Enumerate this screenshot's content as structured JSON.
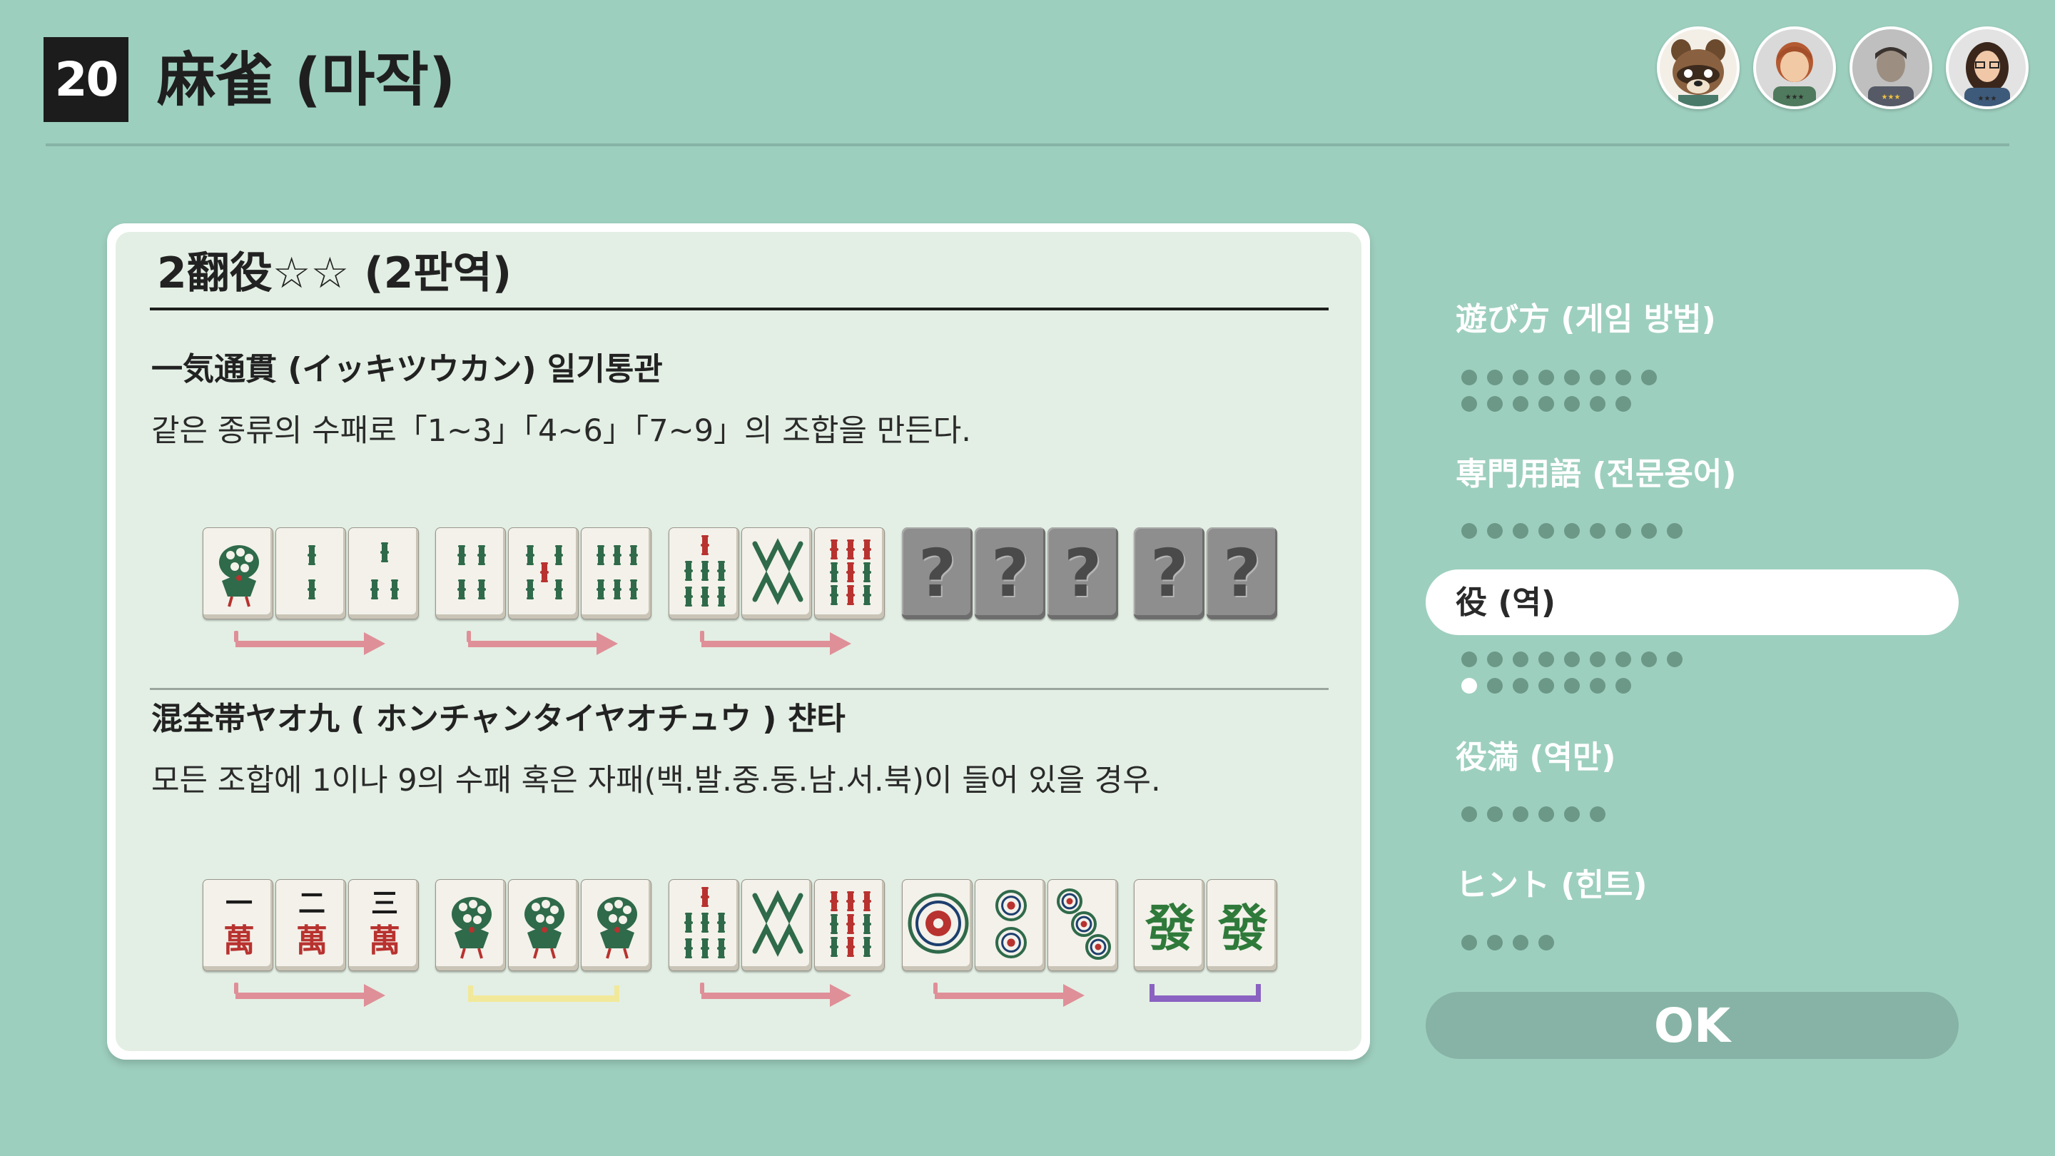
{
  "header": {
    "lesson_number": "20",
    "title": "麻雀 (마작)"
  },
  "players": [
    {
      "name": "tom-nook-avatar"
    },
    {
      "name": "player-avatar-2",
      "stars": "★★★"
    },
    {
      "name": "player-avatar-3",
      "stars": "★★★"
    },
    {
      "name": "player-avatar-4",
      "stars": "★★★"
    }
  ],
  "card": {
    "title": "2翻役☆☆ (2판역)",
    "yaku": [
      {
        "title": "一気通貫 (イッキツウカン) 일기통관",
        "description": "같은 종류의 수패로「1~3」「4~6」「7~9」의 조합을 만든다.",
        "tiles": [
          "sou-1",
          "sou-2",
          "sou-3",
          "sou-4",
          "sou-5",
          "sou-6",
          "sou-7",
          "sou-8",
          "sou-9",
          "unknown",
          "unknown",
          "unknown",
          "unknown",
          "unknown"
        ],
        "unknown_glyph": "?"
      },
      {
        "title": "混全帯ヤオ九 ( ホンチャンタイヤオチュウ ) 챤타",
        "description": "모든 조합에 1이나 9의 수패 혹은 자패(백.발.중.동.남.서.북)이 들어 있을 경우.",
        "tiles": [
          "man-1",
          "man-2",
          "man-3",
          "sou-1",
          "sou-1",
          "sou-1",
          "sou-7",
          "sou-8",
          "sou-9",
          "pin-1",
          "pin-2",
          "pin-3",
          "green-dragon",
          "green-dragon"
        ]
      }
    ],
    "group_markers": [
      [
        "run",
        "run",
        "run",
        "unknown",
        "unknown"
      ],
      [
        "run",
        "triplet",
        "run",
        "run",
        "pair"
      ]
    ],
    "colors": {
      "run": "#df8f98",
      "triplet": "#f1e89a",
      "pair": "#8a62c2"
    }
  },
  "menu": {
    "items": [
      {
        "label": "遊び方 (게임 방법)",
        "dot_rows": [
          8,
          7
        ],
        "active_dot": null,
        "selected": false
      },
      {
        "label": "専門用語 (전문용어)",
        "dot_rows": [
          9
        ],
        "active_dot": null,
        "selected": false
      },
      {
        "label": "役 (역)",
        "dot_rows": [
          9,
          7
        ],
        "active_dot": [
          1,
          0
        ],
        "selected": true
      },
      {
        "label": "役満 (역만)",
        "dot_rows": [
          6
        ],
        "active_dot": null,
        "selected": false
      },
      {
        "label": "ヒント (힌트)",
        "dot_rows": [
          4
        ],
        "active_dot": null,
        "selected": false
      }
    ],
    "ok_label": "OK"
  }
}
